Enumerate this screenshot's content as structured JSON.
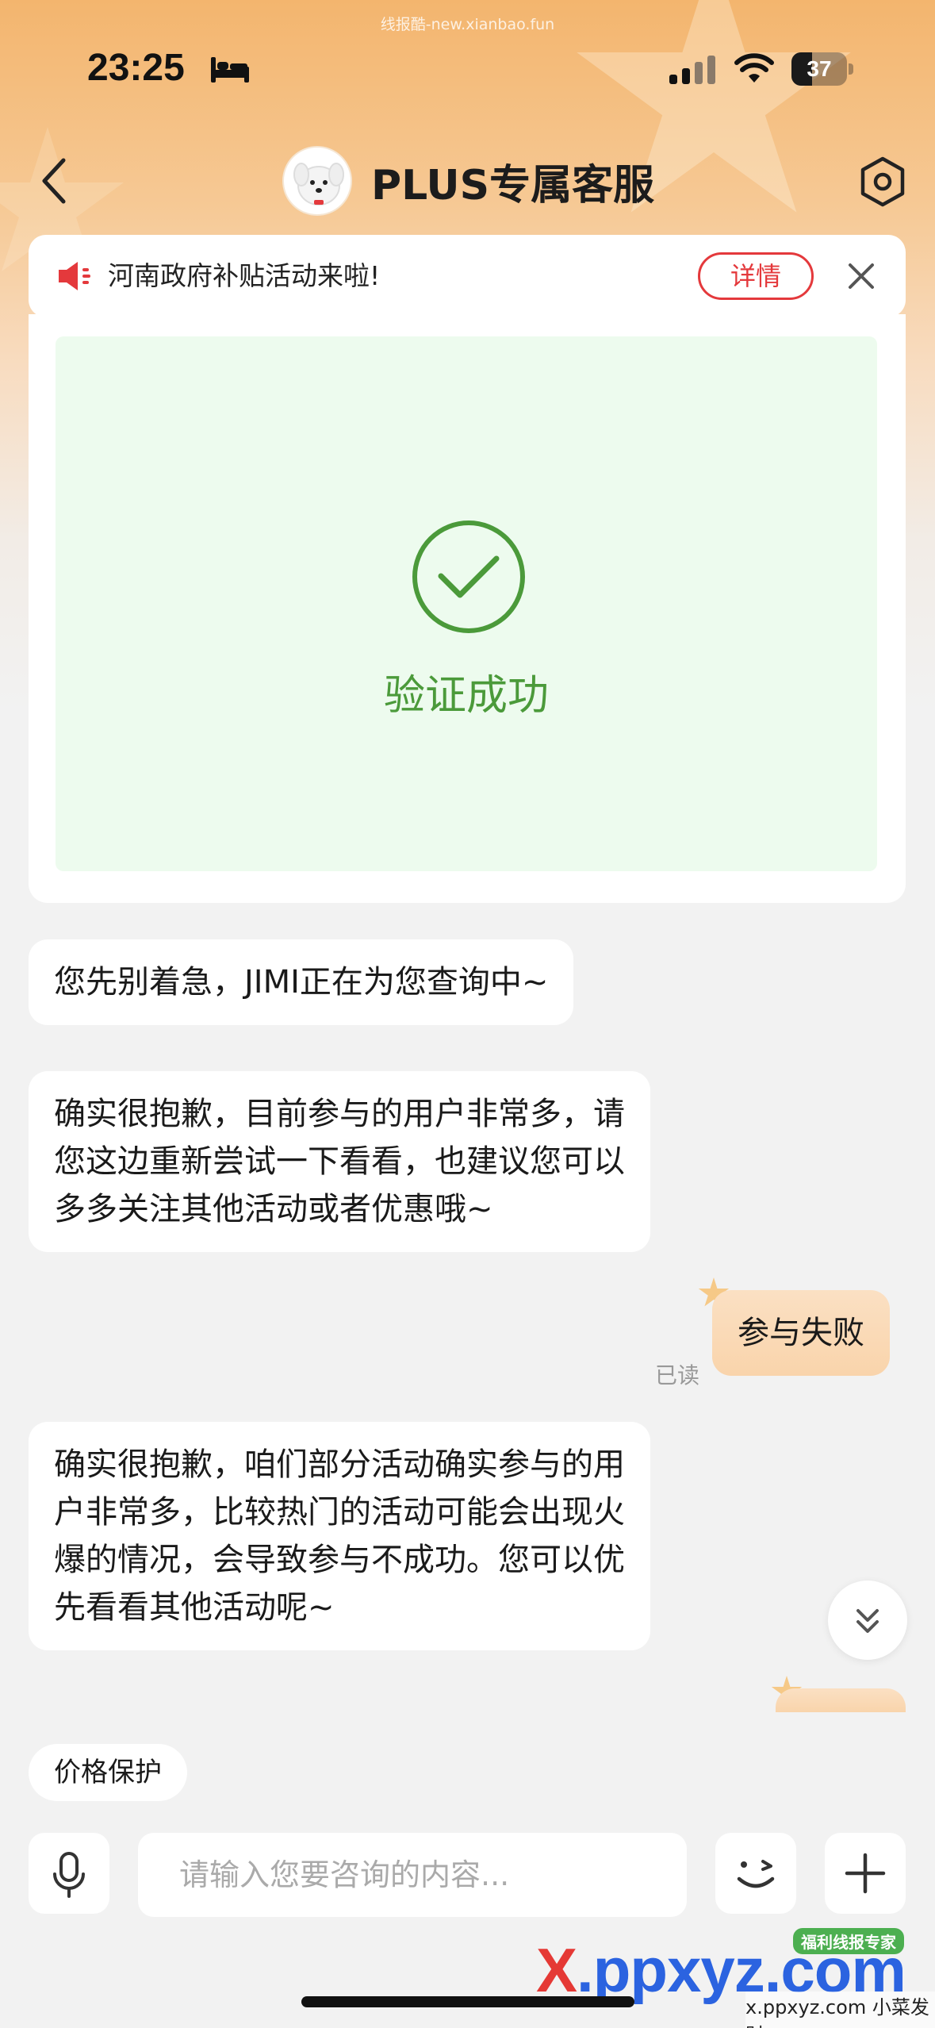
{
  "watermark_top": "线报酷-new.xianbao.fun",
  "status_bar": {
    "time": "23:25",
    "battery_level": "37",
    "battery_fraction": 0.37,
    "icons": [
      "bed-icon",
      "signal-icon",
      "wifi-icon",
      "battery-icon"
    ]
  },
  "nav": {
    "title": "PLUS专属客服",
    "back_icon": "chevron-left-icon",
    "settings_icon": "gear-hexagon-icon"
  },
  "notice": {
    "text": "河南政府补贴活动来啦!",
    "button_label": "详情",
    "speaker_icon": "speaker-icon",
    "close_icon": "close-icon"
  },
  "verify": {
    "status_text": "验证成功",
    "icon": "check-circle-icon",
    "accent_color": "#4b9a3a"
  },
  "messages": [
    {
      "from": "agent",
      "text": "您先别着急，JIMI正在为您查询中~"
    },
    {
      "from": "agent",
      "lines": [
        "确实很抱歉，目前参与的用户非常多，请",
        "您这边重新尝试一下看看，也建议您可以",
        "多多关注其他活动或者优惠哦~"
      ]
    },
    {
      "from": "user",
      "text": "参与失败",
      "status": "已读"
    },
    {
      "from": "agent",
      "lines": [
        "确实很抱歉，咱们部分活动确实参与的用",
        "户非常多，比较热门的活动可能会出现火",
        "爆的情况，会导致参与不成功。您可以优",
        "先看看其他活动呢~"
      ]
    }
  ],
  "quick_chips": [
    "价格保护"
  ],
  "input": {
    "placeholder": "请输入您要咨询的内容...",
    "value": "",
    "mic_icon": "microphone-icon",
    "emoji_icon": "wink-emoji-icon",
    "plus_icon": "plus-icon"
  },
  "site_watermark": {
    "logo_prefix": "X",
    "logo_rest": ".ppxyz.com",
    "badge": "福利线报专家",
    "subtitle": "x.ppxyz.com 小菜发财"
  },
  "colors": {
    "brand_red": "#e4393c",
    "success_green": "#4b9a3a",
    "header_orange": "#f3b56e"
  }
}
